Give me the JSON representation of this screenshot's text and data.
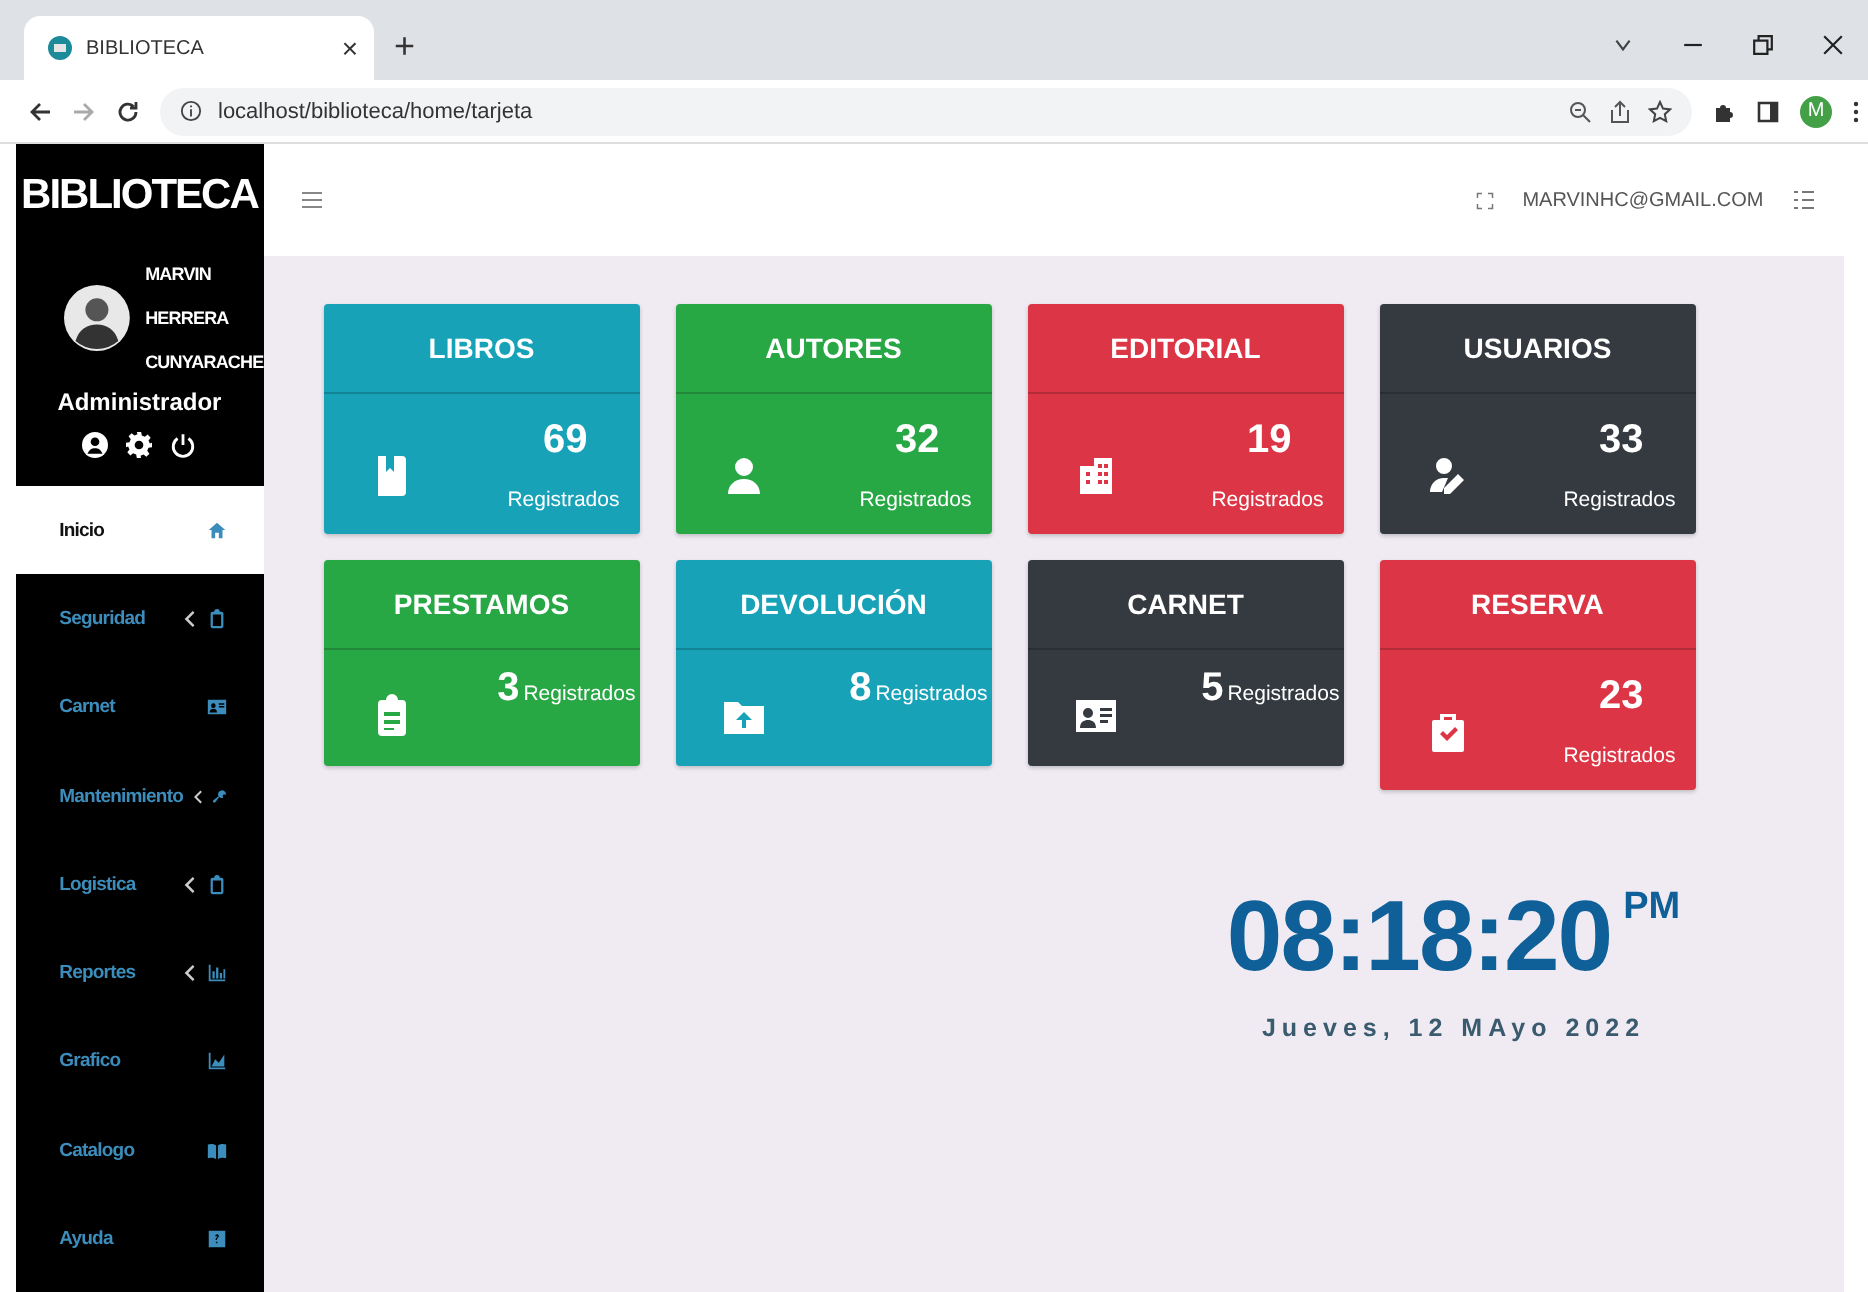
{
  "browser": {
    "tab": {
      "title": "BIBLIOTECA",
      "close": "×"
    },
    "new_tab": "+",
    "address": "localhost/biblioteca/home/tarjeta",
    "profile": "M"
  },
  "sidebar": {
    "brand": "BIBLIOTECA",
    "user": {
      "name": "MARVIN HERRERA CUNYARACHE",
      "role": "Administrador"
    },
    "items": [
      {
        "label": "Inicio",
        "selected": true,
        "submenu": false
      },
      {
        "label": "Seguridad",
        "selected": false,
        "submenu": true
      },
      {
        "label": "Carnet",
        "selected": false,
        "submenu": false
      },
      {
        "label": "Mantenimiento",
        "selected": false,
        "submenu": true
      },
      {
        "label": "Logistica",
        "selected": false,
        "submenu": true
      },
      {
        "label": "Reportes",
        "selected": false,
        "submenu": true
      },
      {
        "label": "Grafico",
        "selected": false,
        "submenu": false
      },
      {
        "label": "Catalogo",
        "selected": false,
        "submenu": false
      },
      {
        "label": "Ayuda",
        "selected": false,
        "submenu": false
      }
    ]
  },
  "header": {
    "email": "MARVINHC@GMAIL.COM"
  },
  "cards": [
    {
      "title": "LIBROS",
      "count": "69",
      "caption": "Registrados",
      "color": "#17a2b8",
      "kind": "stacked"
    },
    {
      "title": "AUTORES",
      "count": "32",
      "caption": "Registrados",
      "color": "#28a745",
      "kind": "stacked"
    },
    {
      "title": "EDITORIAL",
      "count": "19",
      "caption": "Registrados",
      "color": "#dc3545",
      "kind": "stacked"
    },
    {
      "title": "USUARIOS",
      "count": "33",
      "caption": "Registrados",
      "color": "#343a40",
      "kind": "stacked"
    },
    {
      "title": "PRESTAMOS",
      "count": "3",
      "caption": "Registrados",
      "color": "#28a745",
      "kind": "inline"
    },
    {
      "title": "DEVOLUCIÓN",
      "count": "8",
      "caption": "Registrados",
      "color": "#17a2b8",
      "kind": "inline"
    },
    {
      "title": "CARNET",
      "count": "5",
      "caption": "Registrados",
      "color": "#343a40",
      "kind": "inline"
    },
    {
      "title": "RESERVA",
      "count": "23",
      "caption": "Registrados",
      "color": "#dc3545",
      "kind": "stacked"
    }
  ],
  "clock": {
    "time": "08:18:20",
    "meridiem": "PM",
    "date": "Jueves, 12 MAyo 2022"
  }
}
